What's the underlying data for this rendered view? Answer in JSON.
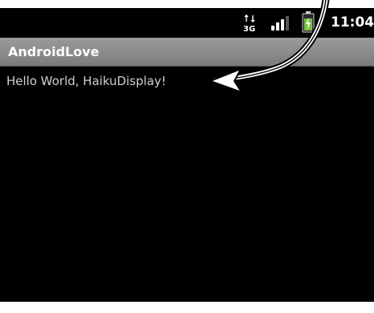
{
  "status_bar": {
    "network_type": "3G",
    "signal_icon": "signal-bars-icon",
    "battery_icon": "battery-charging-icon",
    "time": "11:04"
  },
  "action_bar": {
    "title": "AndroidLove"
  },
  "content": {
    "text": "Hello World, HaikuDisplay!"
  },
  "annotation": {
    "arrow_icon": "curved-arrow-icon",
    "arrow_color": "#ffffff",
    "outline_color": "#000000"
  },
  "colors": {
    "screen_background": "#000000",
    "title_bar": "#8c8c8c",
    "title_text": "#ffffff",
    "body_text": "#d0d0d0",
    "battery_charge": "#7ac13f"
  }
}
